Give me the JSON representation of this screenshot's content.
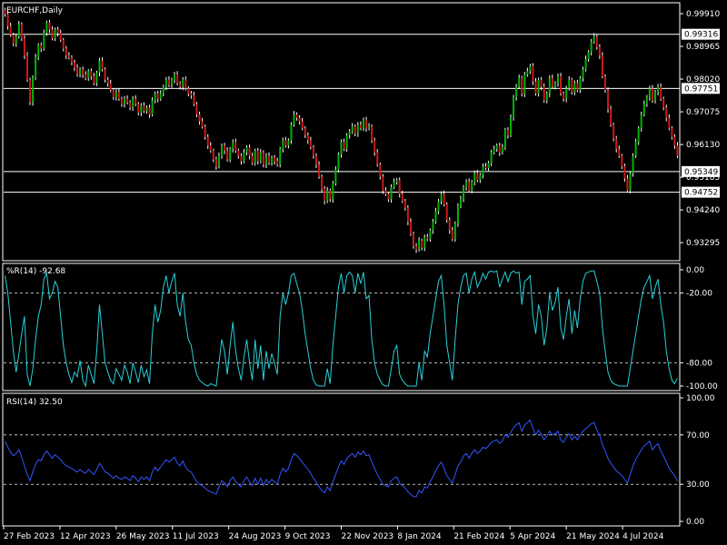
{
  "symbol_label": "EURCHF,Daily",
  "colors": {
    "background": "#000000",
    "frame": "#ffffff",
    "bull": "#00b400",
    "bear": "#cc1a1a",
    "wick": "#ffffff",
    "wpr_line": "#29d0d8",
    "rsi_line": "#3355ff",
    "hline": "#ffffff",
    "level_line": "#bbbbbb"
  },
  "chart_data": [
    {
      "type": "candlestick",
      "title": "EURCHF,Daily",
      "ylim": [
        0.928,
        1.002
      ],
      "y_ticks": [
        "0.99910",
        "0.98965",
        "0.98020",
        "0.97075",
        "0.96130",
        "0.95185",
        "0.94240",
        "0.93295"
      ],
      "y_tick_values": [
        0.9991,
        0.98965,
        0.9802,
        0.97075,
        0.9613,
        0.95185,
        0.9424,
        0.93295
      ],
      "horizontal_lines": [
        {
          "label": "0.99316",
          "value": 0.99316
        },
        {
          "label": "0.97751",
          "value": 0.97751
        },
        {
          "label": "0.95349",
          "value": 0.95349
        },
        {
          "label": "0.94752",
          "value": 0.94752
        }
      ],
      "x_labels": [
        "27 Feb 2023",
        "12 Apr 2023",
        "26 May 2023",
        "11 Jul 2023",
        "24 Aug 2023",
        "9 Oct 2023",
        "22 Nov 2023",
        "8 Jan 2024",
        "21 Feb 2024",
        "5 Apr 2024",
        "21 May 2024",
        "4 Jul 2024"
      ],
      "closes": [
        0.999,
        0.9955,
        0.993,
        0.9905,
        0.9925,
        0.996,
        0.992,
        0.987,
        0.98,
        0.9735,
        0.9805,
        0.9865,
        0.99,
        0.989,
        0.9935,
        0.9965,
        0.9945,
        0.992,
        0.9945,
        0.9935,
        0.9915,
        0.989,
        0.987,
        0.9865,
        0.985,
        0.9835,
        0.9815,
        0.983,
        0.9815,
        0.9805,
        0.9825,
        0.981,
        0.979,
        0.982,
        0.9855,
        0.983,
        0.98,
        0.979,
        0.977,
        0.975,
        0.9765,
        0.9745,
        0.973,
        0.9745,
        0.9735,
        0.972,
        0.9745,
        0.973,
        0.9705,
        0.9725,
        0.971,
        0.972,
        0.97,
        0.974,
        0.976,
        0.9745,
        0.976,
        0.978,
        0.98,
        0.9785,
        0.98,
        0.9815,
        0.979,
        0.978,
        0.98,
        0.9775,
        0.976,
        0.9755,
        0.973,
        0.97,
        0.968,
        0.9665,
        0.9635,
        0.961,
        0.9595,
        0.957,
        0.955,
        0.958,
        0.961,
        0.9595,
        0.957,
        0.96,
        0.962,
        0.9595,
        0.958,
        0.9565,
        0.959,
        0.9605,
        0.958,
        0.956,
        0.9595,
        0.9565,
        0.959,
        0.9555,
        0.958,
        0.956,
        0.9575,
        0.9565,
        0.9555,
        0.96,
        0.9625,
        0.961,
        0.9625,
        0.967,
        0.97,
        0.969,
        0.968,
        0.966,
        0.964,
        0.9625,
        0.9605,
        0.958,
        0.9555,
        0.952,
        0.9485,
        0.945,
        0.948,
        0.9455,
        0.95,
        0.954,
        0.9585,
        0.962,
        0.96,
        0.964,
        0.965,
        0.9665,
        0.9645,
        0.967,
        0.966,
        0.9685,
        0.966,
        0.9665,
        0.9625,
        0.959,
        0.9555,
        0.952,
        0.948,
        0.947,
        0.9455,
        0.949,
        0.9505,
        0.951,
        0.947,
        0.945,
        0.943,
        0.939,
        0.9355,
        0.932,
        0.931,
        0.9335,
        0.9315,
        0.9345,
        0.934,
        0.9365,
        0.939,
        0.942,
        0.945,
        0.947,
        0.944,
        0.9395,
        0.9365,
        0.934,
        0.9385,
        0.9435,
        0.9455,
        0.949,
        0.9505,
        0.948,
        0.9505,
        0.953,
        0.951,
        0.9525,
        0.955,
        0.9545,
        0.956,
        0.959,
        0.96,
        0.961,
        0.959,
        0.9605,
        0.9655,
        0.964,
        0.969,
        0.975,
        0.978,
        0.9805,
        0.976,
        0.9815,
        0.9825,
        0.984,
        0.9795,
        0.976,
        0.98,
        0.978,
        0.974,
        0.976,
        0.9805,
        0.978,
        0.979,
        0.981,
        0.976,
        0.9745,
        0.9775,
        0.98,
        0.9765,
        0.979,
        0.977,
        0.9805,
        0.983,
        0.986,
        0.988,
        0.991,
        0.9925,
        0.9895,
        0.987,
        0.981,
        0.977,
        0.9715,
        0.967,
        0.963,
        0.96,
        0.958,
        0.955,
        0.9515,
        0.948,
        0.953,
        0.958,
        0.962,
        0.966,
        0.97,
        0.973,
        0.975,
        0.9775,
        0.974,
        0.9765,
        0.978,
        0.9745,
        0.972,
        0.969,
        0.966,
        0.9635,
        0.961,
        0.958
      ]
    },
    {
      "type": "line",
      "title": "%R(14) -92.68",
      "ylim": [
        -100,
        0
      ],
      "y_ticks": [
        "0.00",
        "-20.00",
        "-80.00",
        "-100.00"
      ],
      "y_tick_values": [
        0,
        -20,
        -80,
        -100
      ],
      "levels": [
        -20,
        -80
      ],
      "series": [
        {
          "values": [
            -5,
            -20,
            -45,
            -70,
            -88,
            -72,
            -55,
            -40,
            -90,
            -100,
            -85,
            -60,
            -40,
            -30,
            -8,
            -3,
            -25,
            -20,
            -10,
            -15,
            -40,
            -65,
            -80,
            -90,
            -97,
            -88,
            -92,
            -78,
            -95,
            -100,
            -82,
            -90,
            -98,
            -70,
            -30,
            -55,
            -80,
            -88,
            -95,
            -98,
            -85,
            -90,
            -95,
            -82,
            -88,
            -98,
            -80,
            -88,
            -97,
            -82,
            -92,
            -86,
            -98,
            -55,
            -30,
            -45,
            -35,
            -15,
            -5,
            -20,
            -10,
            -3,
            -30,
            -40,
            -20,
            -45,
            -60,
            -65,
            -80,
            -90,
            -95,
            -97,
            -99,
            -100,
            -98,
            -99,
            -100,
            -80,
            -60,
            -70,
            -90,
            -65,
            -45,
            -70,
            -85,
            -95,
            -75,
            -60,
            -80,
            -95,
            -60,
            -85,
            -65,
            -95,
            -70,
            -85,
            -72,
            -80,
            -90,
            -40,
            -20,
            -30,
            -20,
            -5,
            -3,
            -12,
            -20,
            -35,
            -55,
            -70,
            -85,
            -95,
            -99,
            -100,
            -100,
            -100,
            -85,
            -98,
            -65,
            -40,
            -15,
            -3,
            -20,
            -5,
            -2,
            -5,
            -20,
            -3,
            -12,
            -2,
            -25,
            -22,
            -60,
            -80,
            -90,
            -95,
            -99,
            -100,
            -100,
            -85,
            -70,
            -65,
            -90,
            -95,
            -98,
            -100,
            -100,
            -100,
            -100,
            -80,
            -95,
            -70,
            -75,
            -55,
            -40,
            -25,
            -10,
            -5,
            -30,
            -65,
            -80,
            -95,
            -60,
            -30,
            -15,
            -5,
            -3,
            -20,
            -8,
            -2,
            -15,
            -10,
            -3,
            -8,
            -2,
            -1,
            -2,
            -1,
            -15,
            -8,
            -2,
            -10,
            -3,
            -1,
            -3,
            -2,
            -30,
            -10,
            -8,
            -5,
            -40,
            -55,
            -30,
            -40,
            -65,
            -50,
            -20,
            -35,
            -28,
            -15,
            -50,
            -60,
            -40,
            -25,
            -55,
            -35,
            -50,
            -25,
            -10,
            -3,
            -2,
            -1,
            -1,
            -10,
            -20,
            -50,
            -70,
            -88,
            -95,
            -98,
            -99,
            -100,
            -100,
            -100,
            -100,
            -85,
            -70,
            -55,
            -40,
            -25,
            -15,
            -10,
            -5,
            -25,
            -15,
            -8,
            -30,
            -45,
            -70,
            -85,
            -95,
            -98,
            -93
          ]
        }
      ]
    },
    {
      "type": "line",
      "title": "RSI(14) 32.50",
      "ylim": [
        0,
        100
      ],
      "y_ticks": [
        "100.00",
        "70.00",
        "30.00",
        "0.00"
      ],
      "y_tick_values": [
        100,
        70,
        30,
        0
      ],
      "levels": [
        70,
        30
      ],
      "series": [
        {
          "values": [
            65,
            60,
            56,
            53,
            55,
            58,
            52,
            45,
            38,
            33,
            40,
            46,
            50,
            49,
            54,
            57,
            54,
            51,
            54,
            52,
            50,
            47,
            45,
            44,
            43,
            41,
            40,
            42,
            40,
            39,
            42,
            40,
            38,
            42,
            47,
            44,
            40,
            39,
            37,
            35,
            37,
            35,
            34,
            36,
            35,
            33,
            37,
            35,
            32,
            36,
            34,
            36,
            33,
            40,
            44,
            41,
            44,
            47,
            50,
            48,
            50,
            52,
            47,
            45,
            49,
            44,
            41,
            40,
            36,
            32,
            30,
            29,
            27,
            25,
            24,
            23,
            22,
            28,
            33,
            31,
            28,
            33,
            36,
            32,
            30,
            28,
            33,
            36,
            32,
            29,
            35,
            30,
            35,
            29,
            34,
            31,
            34,
            32,
            30,
            38,
            43,
            40,
            43,
            50,
            55,
            53,
            51,
            48,
            45,
            42,
            39,
            35,
            32,
            28,
            25,
            23,
            28,
            25,
            32,
            38,
            44,
            49,
            46,
            51,
            53,
            55,
            52,
            56,
            54,
            57,
            53,
            54,
            48,
            43,
            38,
            34,
            30,
            29,
            28,
            33,
            35,
            36,
            31,
            29,
            27,
            24,
            22,
            20,
            20,
            25,
            23,
            28,
            27,
            32,
            36,
            41,
            45,
            48,
            43,
            37,
            34,
            31,
            38,
            45,
            48,
            53,
            55,
            51,
            55,
            58,
            55,
            57,
            60,
            59,
            61,
            64,
            65,
            66,
            63,
            65,
            70,
            68,
            72,
            76,
            78,
            80,
            73,
            78,
            80,
            82,
            75,
            70,
            74,
            71,
            66,
            69,
            73,
            70,
            71,
            73,
            66,
            64,
            68,
            71,
            66,
            69,
            66,
            70,
            73,
            75,
            77,
            79,
            80,
            74,
            70,
            62,
            57,
            51,
            47,
            44,
            41,
            39,
            37,
            34,
            31,
            38,
            45,
            50,
            54,
            58,
            61,
            63,
            65,
            58,
            61,
            63,
            57,
            53,
            48,
            43,
            40,
            37,
            32.5
          ]
        }
      ]
    }
  ]
}
